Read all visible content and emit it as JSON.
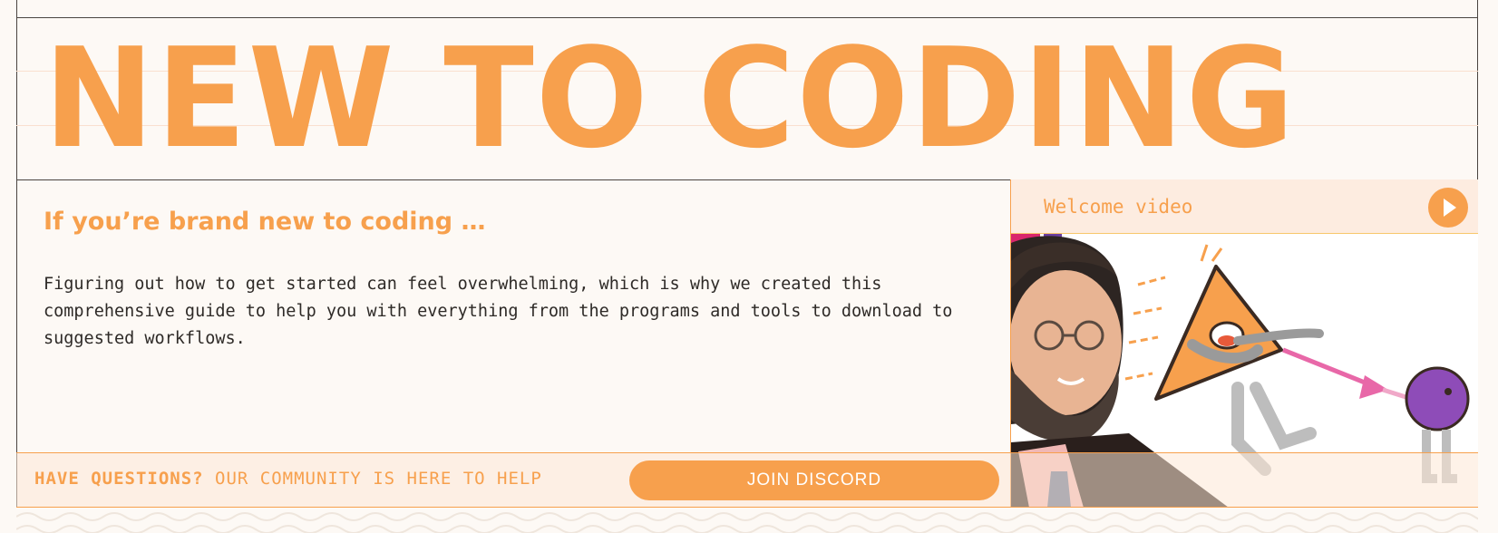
{
  "hero": {
    "title": "NEW TO CODING"
  },
  "intro": {
    "heading": "If you’re brand new to coding …",
    "body": "Figuring out how to get started can feel overwhelming, which is why we created this comprehensive guide to help you with everything from the programs and tools to download to suggested workflows."
  },
  "video": {
    "label": "Welcome video",
    "play_icon": "play-icon"
  },
  "cta": {
    "strong": "HAVE QUESTIONS?",
    "soft": "OUR COMMUNITY IS HERE TO HELP",
    "button_label": "JOIN DISCORD"
  },
  "colors": {
    "accent": "#f7a04d",
    "background": "#fdf9f5",
    "text": "#2e2a27",
    "video_header_bg": "#fdece0"
  }
}
